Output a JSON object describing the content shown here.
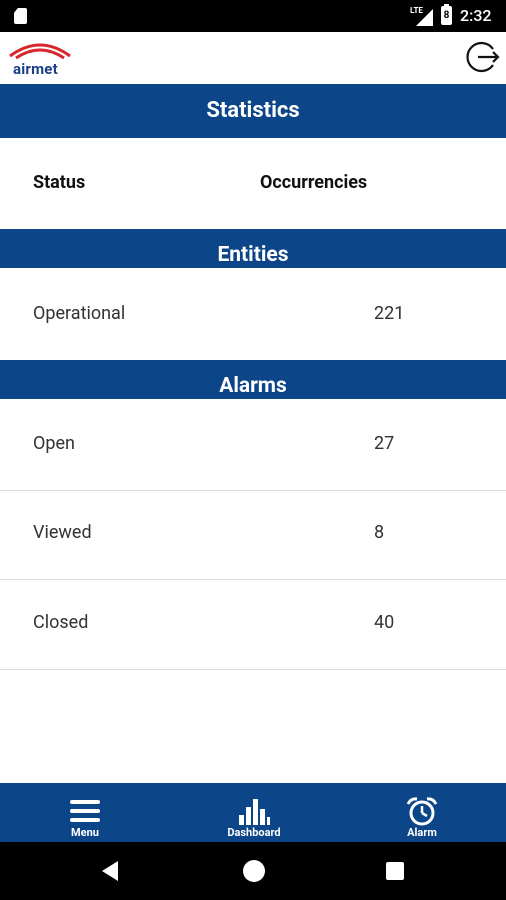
{
  "status_bar": {
    "network": "LTE",
    "battery_level": "8",
    "time": "2:32"
  },
  "header": {
    "logo_text": "airmet",
    "logout_icon": "logout-icon"
  },
  "title_bar": {
    "title": "Statistics"
  },
  "columns": {
    "status": "Status",
    "occurrences": "Occurrencies"
  },
  "entities": {
    "title": "Entities",
    "rows": [
      {
        "label": "Operational",
        "value": "221"
      }
    ]
  },
  "alarms": {
    "title": "Alarms",
    "rows": [
      {
        "label": "Open",
        "value": "27"
      },
      {
        "label": "Viewed",
        "value": "8"
      },
      {
        "label": "Closed",
        "value": "40"
      }
    ]
  },
  "bottom_nav": {
    "items": [
      {
        "label": "Menu",
        "icon": "menu-icon"
      },
      {
        "label": "Dashboard",
        "icon": "bar-chart-icon"
      },
      {
        "label": "Alarm",
        "icon": "alarm-clock-icon"
      }
    ]
  },
  "colors": {
    "primary": "#0d4589",
    "logo_red": "#d7262e",
    "text": "#333333"
  }
}
